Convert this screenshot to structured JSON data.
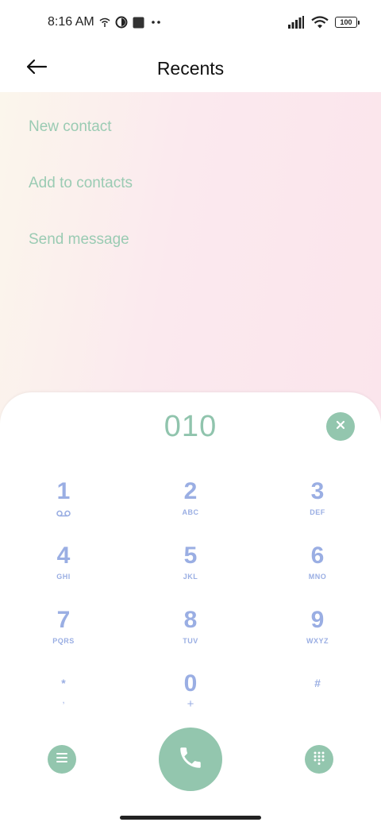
{
  "status_bar": {
    "time": "8:16 AM",
    "icons": [
      "wifi-calling-icon",
      "data-saver-icon",
      "square-notification-icon",
      "more-dots-icon",
      "signal-icon",
      "wifi-icon"
    ],
    "battery": "100"
  },
  "app_bar": {
    "title": "Recents",
    "back_icon": "arrow-left-icon"
  },
  "actions": [
    {
      "label": "New contact"
    },
    {
      "label": "Add to contacts"
    },
    {
      "label": "Send message"
    }
  ],
  "dialer": {
    "number": "010",
    "clear_icon": "close-icon",
    "keys": [
      {
        "digit": "1",
        "letters": ""
      },
      {
        "digit": "2",
        "letters": "ABC"
      },
      {
        "digit": "3",
        "letters": "DEF"
      },
      {
        "digit": "4",
        "letters": "GHI"
      },
      {
        "digit": "5",
        "letters": "JKL"
      },
      {
        "digit": "6",
        "letters": "MNO"
      },
      {
        "digit": "7",
        "letters": "PQRS"
      },
      {
        "digit": "8",
        "letters": "TUV"
      },
      {
        "digit": "9",
        "letters": "WXYZ"
      },
      {
        "digit": "*",
        "letters": ","
      },
      {
        "digit": "0",
        "letters": "+"
      },
      {
        "digit": "#",
        "letters": ""
      }
    ],
    "voicemail_icon": "voicemail-icon",
    "bottom_buttons": [
      "menu-icon",
      "phone-icon",
      "dialpad-icon"
    ]
  },
  "colors": {
    "accent_green": "#93c6ae",
    "key_blue": "#9aaee3",
    "action_text": "#9acbb3"
  }
}
